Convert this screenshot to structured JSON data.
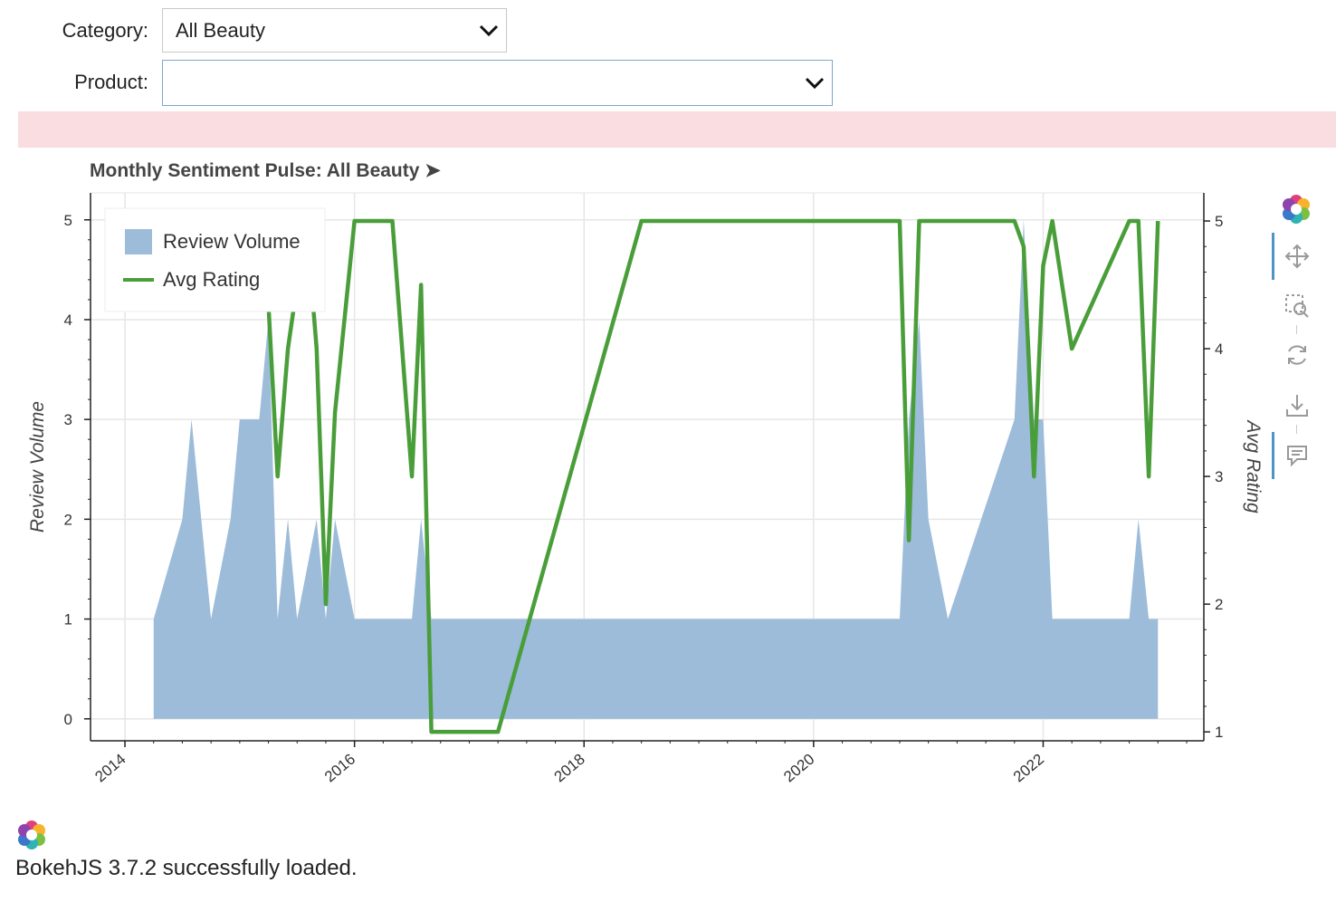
{
  "controls": {
    "category_label": "Category:",
    "category_value": "All Beauty",
    "product_label": "Product:",
    "product_value": ""
  },
  "chart_title": "Monthly Sentiment Pulse: All Beauty ➤",
  "footer": {
    "text": "BokehJS 3.7.2 successfully loaded."
  },
  "colors": {
    "area": "#9cbcda",
    "line": "#4a9e3a",
    "banner": "#f9dde0",
    "accent": "#4f94c7"
  },
  "toolbar": {
    "icons": [
      "bokeh-logo-icon",
      "pan-icon",
      "box-zoom-icon",
      "reset-icon",
      "save-icon",
      "hover-icon"
    ]
  },
  "chart_data": {
    "type": "area+line",
    "title": "Monthly Sentiment Pulse: All Beauty ➤",
    "xlabel": "",
    "ylabel": "Review Volume",
    "y2label": "Avg Rating",
    "xlim": [
      2013.7,
      2023.4
    ],
    "ylim": [
      -0.22,
      5.27
    ],
    "y2lim": [
      0.93,
      5.22
    ],
    "xticks": [
      "2014",
      "2016",
      "2018",
      "2020",
      "2022"
    ],
    "yticks": [
      "0",
      "1",
      "2",
      "3",
      "4",
      "5"
    ],
    "y2ticks": [
      "1",
      "2",
      "3",
      "4",
      "5"
    ],
    "grid": true,
    "legend_position": "top-left",
    "series": [
      {
        "name": "Review Volume",
        "kind": "area",
        "axis": "left",
        "x": [
          2014.25,
          2014.5,
          2014.58,
          2014.75,
          2014.92,
          2015.0,
          2015.17,
          2015.25,
          2015.33,
          2015.42,
          2015.5,
          2015.67,
          2015.75,
          2015.83,
          2016.0,
          2016.08,
          2016.5,
          2016.58,
          2016.67,
          2016.75,
          2020.75,
          2020.83,
          2020.92,
          2021.0,
          2021.17,
          2021.75,
          2021.83,
          2021.92,
          2022.0,
          2022.08,
          2022.75,
          2022.83,
          2022.92,
          2023.0
        ],
        "y": [
          1,
          2,
          3,
          1,
          2,
          3,
          3,
          4,
          1,
          2,
          1,
          2,
          1,
          2,
          1,
          1,
          1,
          2,
          1,
          1,
          1,
          3,
          4,
          2,
          1,
          3,
          5,
          3,
          3,
          1,
          1,
          2,
          1,
          1
        ]
      },
      {
        "name": "Avg Rating",
        "kind": "line",
        "axis": "right",
        "x": [
          2014.25,
          2014.58,
          2014.83,
          2015.0,
          2015.17,
          2015.25,
          2015.33,
          2015.42,
          2015.58,
          2015.67,
          2015.75,
          2015.83,
          2016.0,
          2016.33,
          2016.5,
          2016.58,
          2016.67,
          2017.25,
          2018.5,
          2020.75,
          2020.83,
          2020.92,
          2021.75,
          2021.83,
          2021.92,
          2022.0,
          2022.08,
          2022.25,
          2022.75,
          2022.83,
          2022.92,
          2023.0
        ],
        "y": [
          5,
          4.35,
          5,
          5,
          4.5,
          4.35,
          3,
          4,
          5,
          4,
          2,
          3.5,
          5,
          5,
          3,
          4.5,
          1,
          1,
          5,
          5,
          2.5,
          5,
          5,
          4.8,
          3,
          4.65,
          5,
          4,
          5,
          5,
          3,
          5
        ]
      }
    ]
  }
}
